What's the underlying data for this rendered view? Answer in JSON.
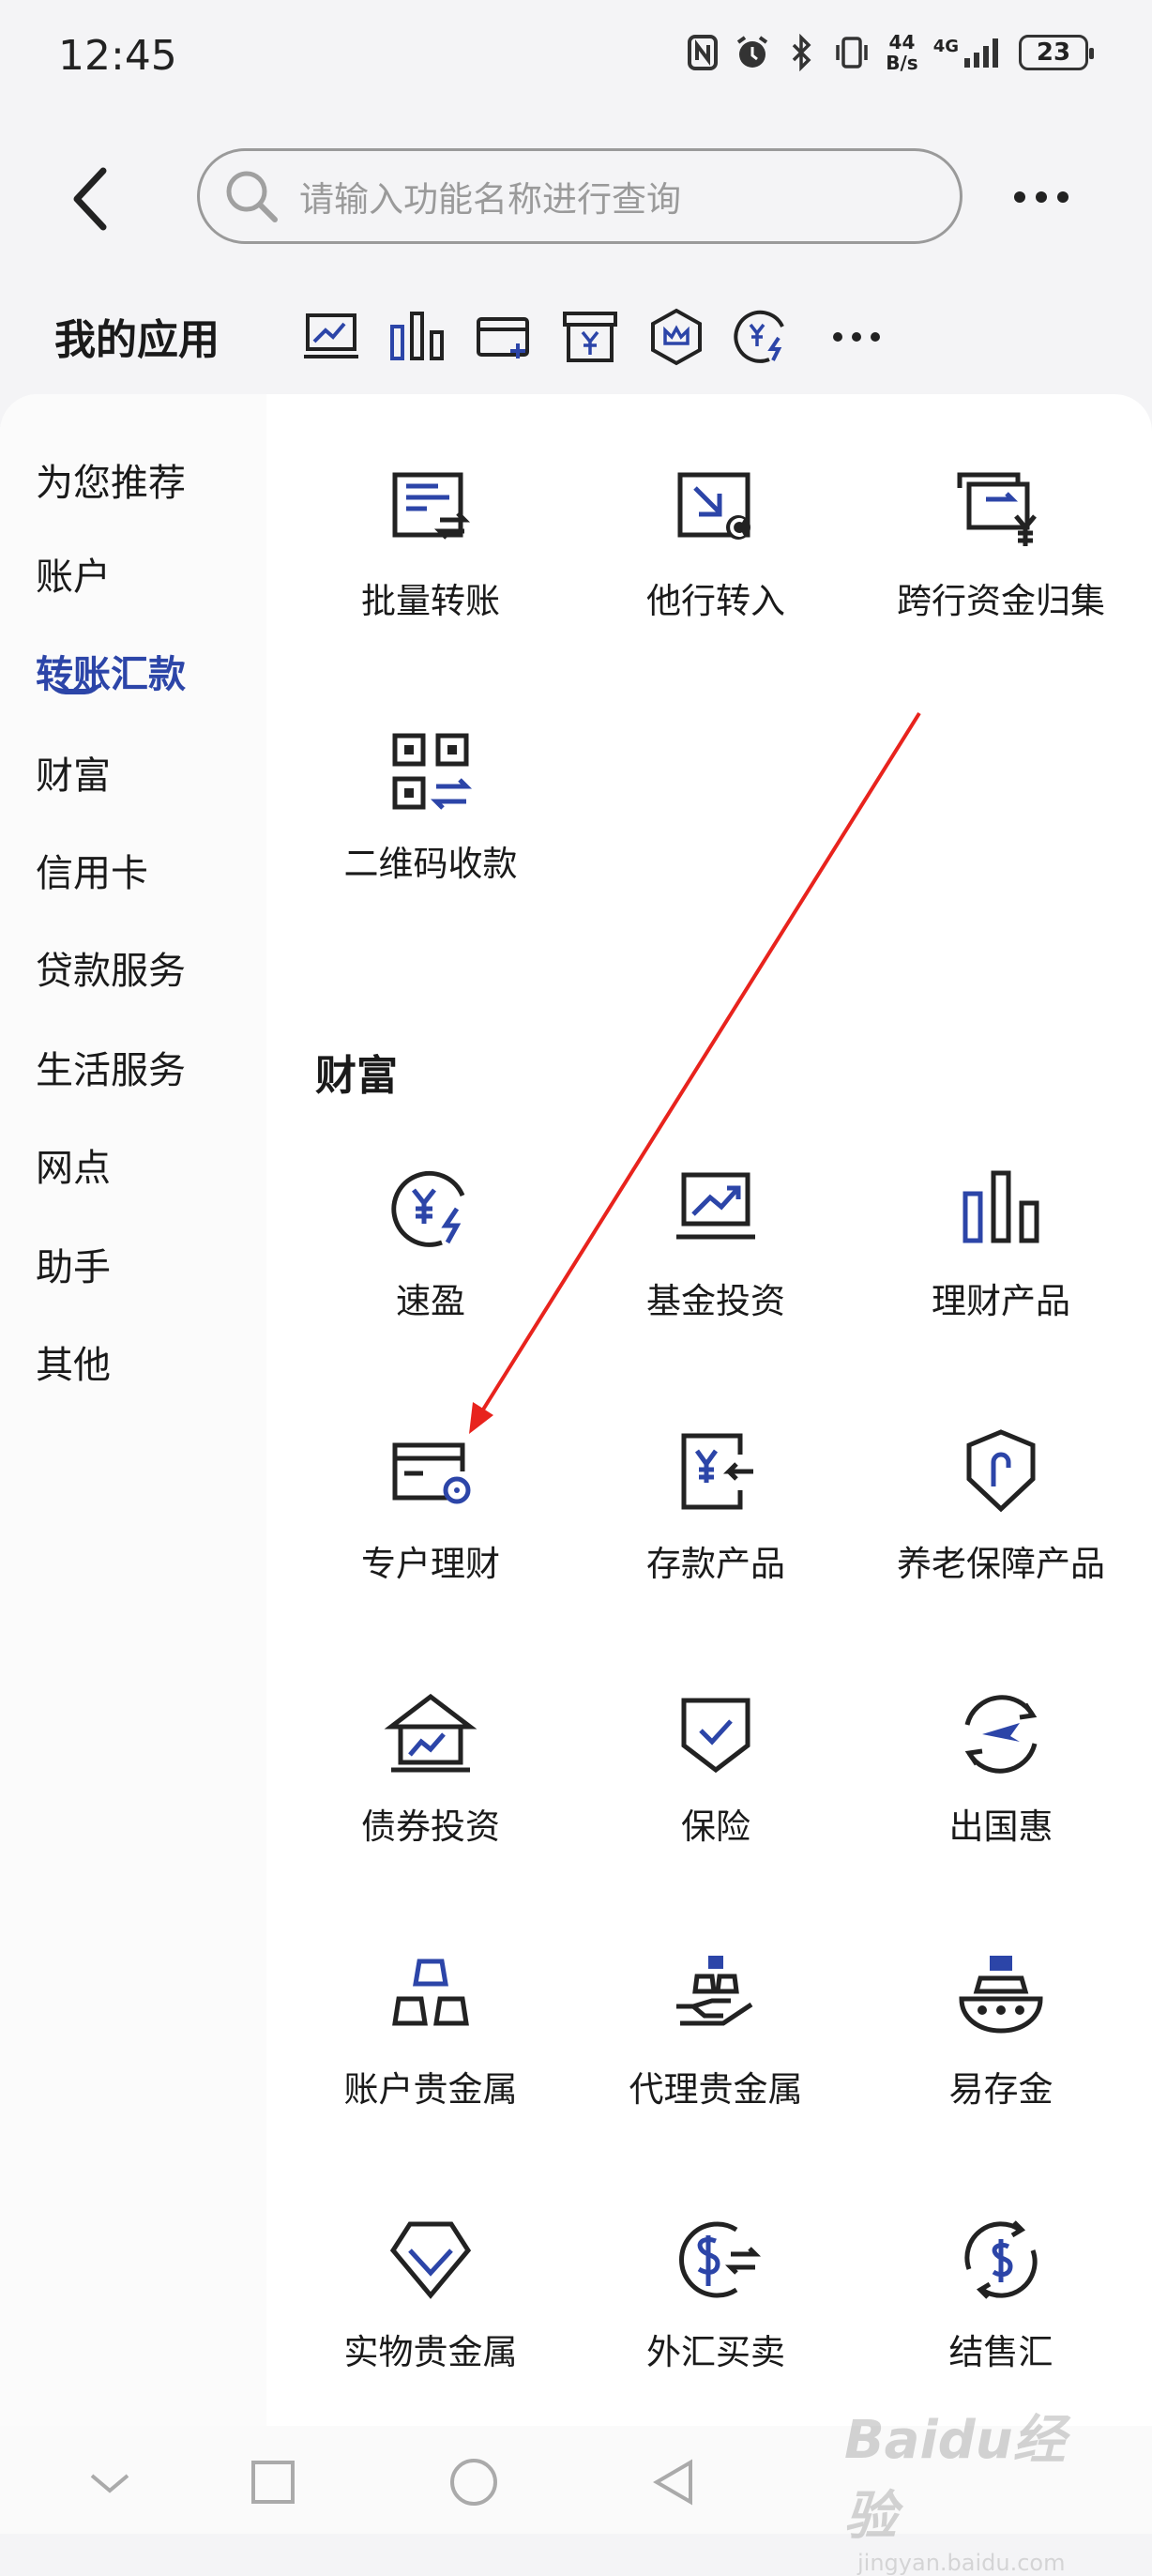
{
  "status_bar": {
    "time": "12:45",
    "net_speed_top": "44",
    "net_speed_bottom": "B/s",
    "signal_label": "4G",
    "battery": "23"
  },
  "search": {
    "placeholder": "请输入功能名称进行查询"
  },
  "my_apps": {
    "title": "我的应用",
    "icons": [
      "fund-chart-icon",
      "bar-chart-icon",
      "card-add-icon",
      "yen-box-icon",
      "crown-hex-icon",
      "yen-speed-icon"
    ]
  },
  "sidebar": {
    "items": [
      "为您推荐",
      "账户",
      "转账汇款",
      "财富",
      "信用卡",
      "贷款服务",
      "生活服务",
      "网点",
      "助手",
      "其他"
    ],
    "active_index": 2
  },
  "transfer": {
    "items": [
      "批量转账",
      "他行转入",
      "跨行资金归集",
      "二维码收款"
    ]
  },
  "wealth": {
    "title": "财富",
    "items": [
      "速盈",
      "基金投资",
      "理财产品",
      "专户理财",
      "存款产品",
      "养老保障产品",
      "债券投资",
      "保险",
      "出国惠",
      "账户贵金属",
      "代理贵金属",
      "易存金",
      "实物贵金属",
      "外汇买卖",
      "结售汇"
    ]
  },
  "watermark": {
    "text": "Baidu经验",
    "sub": "jingyan.baidu.com"
  },
  "colors": {
    "accent": "#2c45a8",
    "arrow": "#e8231d"
  }
}
